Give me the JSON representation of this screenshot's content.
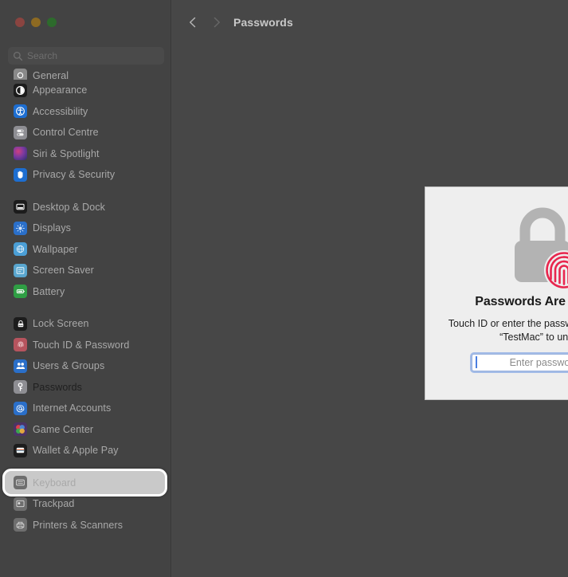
{
  "window": {
    "traffic_lights": [
      "close",
      "minimize",
      "maximize"
    ]
  },
  "search": {
    "placeholder": "Search",
    "value": "",
    "icon": "search-icon"
  },
  "sidebar": {
    "groups": [
      {
        "items": [
          {
            "label": "General",
            "icon": "gear-icon",
            "icon_bg": "#8a8a8a",
            "clipped": true
          },
          {
            "label": "Appearance",
            "icon": "appearance-icon",
            "icon_bg": "#1c1c1c"
          },
          {
            "label": "Accessibility",
            "icon": "accessibility-icon",
            "icon_bg": "#1d6ed1"
          },
          {
            "label": "Control Centre",
            "icon": "control-centre-icon",
            "icon_bg": "#8e8e93"
          },
          {
            "label": "Siri & Spotlight",
            "icon": "siri-icon",
            "icon_bg": "#3a2a52"
          },
          {
            "label": "Privacy & Security",
            "icon": "privacy-icon",
            "icon_bg": "#1d6ed1"
          }
        ]
      },
      {
        "items": [
          {
            "label": "Desktop & Dock",
            "icon": "desktop-dock-icon",
            "icon_bg": "#1c1c1c"
          },
          {
            "label": "Displays",
            "icon": "displays-icon",
            "icon_bg": "#2a6fc9"
          },
          {
            "label": "Wallpaper",
            "icon": "wallpaper-icon",
            "icon_bg": "#4b9fd6"
          },
          {
            "label": "Screen Saver",
            "icon": "screen-saver-icon",
            "icon_bg": "#59a6cf"
          },
          {
            "label": "Battery",
            "icon": "battery-icon",
            "icon_bg": "#2f9e44"
          }
        ]
      },
      {
        "items": [
          {
            "label": "Lock Screen",
            "icon": "lock-screen-icon",
            "icon_bg": "#1c1c1c"
          },
          {
            "label": "Touch ID & Password",
            "icon": "touch-id-icon",
            "icon_bg": "#b6545e"
          },
          {
            "label": "Users & Groups",
            "icon": "users-groups-icon",
            "icon_bg": "#2a6fc9"
          },
          {
            "label": "Passwords",
            "icon": "key-icon",
            "icon_bg": "#8e8e93",
            "selected": true,
            "highlighted": true
          },
          {
            "label": "Internet Accounts",
            "icon": "at-sign-icon",
            "icon_bg": "#2a6fc9"
          },
          {
            "label": "Game Center",
            "icon": "game-center-icon",
            "icon_bg": "#6d4a8e"
          },
          {
            "label": "Wallet & Apple Pay",
            "icon": "wallet-icon",
            "icon_bg": "#1c1c1c"
          }
        ]
      },
      {
        "items": [
          {
            "label": "Keyboard",
            "icon": "keyboard-icon",
            "icon_bg": "#6e6e6e"
          },
          {
            "label": "Trackpad",
            "icon": "trackpad-icon",
            "icon_bg": "#6e6e6e"
          },
          {
            "label": "Printers & Scanners",
            "icon": "printer-icon",
            "icon_bg": "#6e6e6e"
          }
        ]
      }
    ]
  },
  "toolbar": {
    "title": "Passwords",
    "back_icon": "chevron-left-icon",
    "forward_icon": "chevron-right-icon"
  },
  "dialog": {
    "graphic": "locked-padlock-with-fingerprint-icon",
    "heading": "Passwords Are Locked",
    "body": "Touch ID or enter the password for the user “TestMac” to unlock.",
    "password_placeholder": "Enter password",
    "password_value": "",
    "focus_color": "#6491e1"
  },
  "colors": {
    "window_bg": "#474747",
    "sidebar_bg": "#434343",
    "dialog_bg": "#eeeeee",
    "fingerprint": "#e8264e",
    "padlock": "#b0b0b0",
    "highlight_ring": "#ffffff"
  }
}
